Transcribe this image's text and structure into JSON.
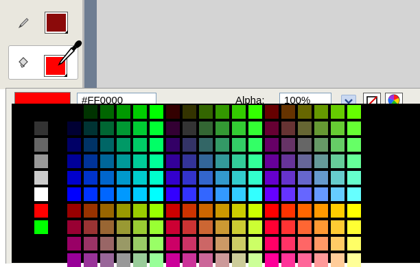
{
  "toolbar": {
    "stroke_tool_icon": "pencil-icon",
    "fill_tool_icon": "paint-bucket-icon",
    "stroke_color": "#8b0a0a",
    "fill_color": "#ff0000",
    "eyedropper_icon": "eyedropper-icon"
  },
  "color_panel": {
    "current_color": "#ff0000",
    "hex_value": "#FF0000",
    "alpha_label": "Alpha:",
    "alpha_value": "100%",
    "dropdown_icon": "chevron-down-icon",
    "no_color_icon": "no-color-icon",
    "color_wheel_icon": "color-wheel-icon"
  },
  "palette": {
    "left_column": [
      "#000000",
      "#333333",
      "#666666",
      "#999999",
      "#cccccc",
      "#ffffff",
      "#ff0000",
      "#00ff00"
    ],
    "levels": [
      "00",
      "33",
      "66",
      "99",
      "cc",
      "ff"
    ]
  }
}
